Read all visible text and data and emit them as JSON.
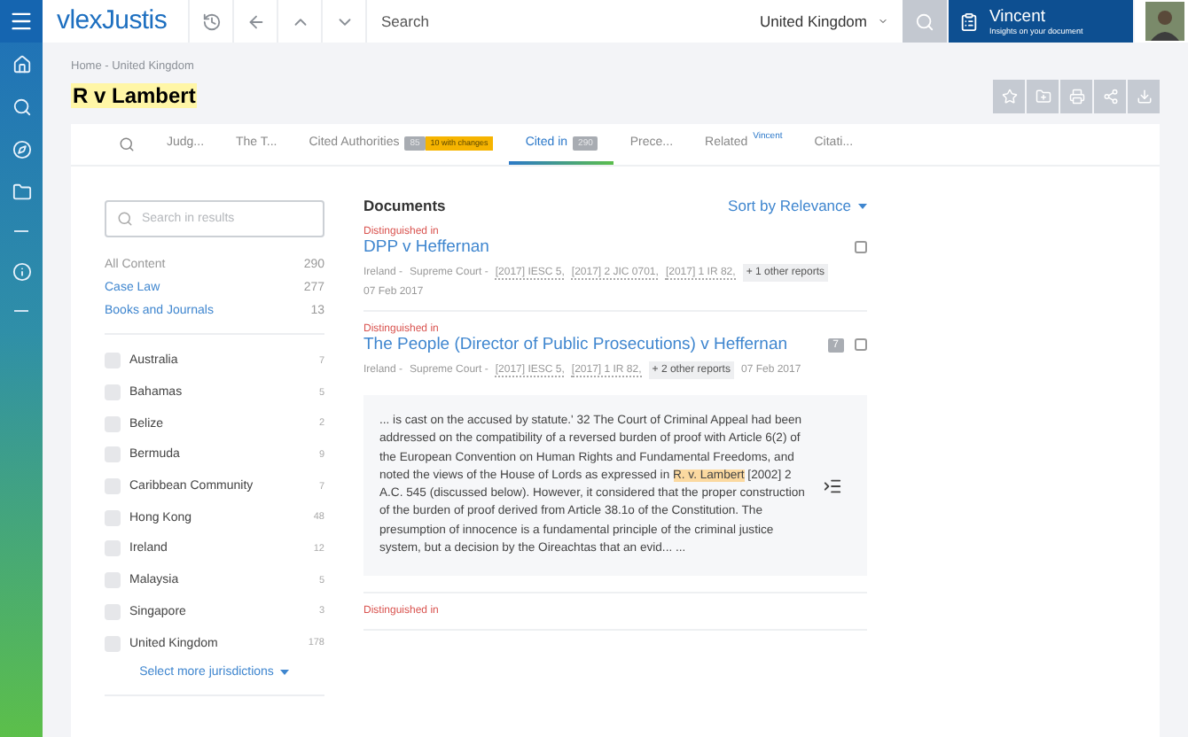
{
  "topbar": {
    "logo": "vlexJustis",
    "search_placeholder": "Search",
    "country": "United Kingdom",
    "assistant": {
      "name": "Vincent",
      "subtitle": "Insights on your document"
    }
  },
  "breadcrumb": [
    "Home",
    "United Kingdom"
  ],
  "breadcrumb_separator": "-",
  "title": "R v Lambert",
  "tabs": [
    {
      "label": "Judg...",
      "selected": false
    },
    {
      "label": "The T...",
      "selected": false
    },
    {
      "label": "Cited Authorities",
      "count": "85",
      "note": "10 with changes",
      "selected": false
    },
    {
      "label": "Cited in",
      "count": "290",
      "selected": true
    },
    {
      "label": "Prece...",
      "selected": false
    },
    {
      "label": "Related",
      "sup": "Vincent",
      "selected": false
    },
    {
      "label": "Citati...",
      "selected": false
    }
  ],
  "results_search": {
    "placeholder": "Search in results"
  },
  "content_filters": [
    {
      "label": "All Content",
      "count": "290",
      "selected": true
    },
    {
      "label": "Case Law",
      "count": "277",
      "selected": false
    },
    {
      "label": "Books and Journals",
      "count": "13",
      "selected": false
    }
  ],
  "jurisdictions": [
    {
      "label": "Australia",
      "count": "7",
      "checked": false
    },
    {
      "label": "Bahamas",
      "count": "5",
      "checked": false
    },
    {
      "label": "Belize",
      "count": "2",
      "checked": false
    },
    {
      "label": "Bermuda",
      "count": "9",
      "checked": false
    },
    {
      "label": "Caribbean Community",
      "count": "7",
      "checked": false
    },
    {
      "label": "Hong Kong",
      "count": "48",
      "checked": false
    },
    {
      "label": "Ireland",
      "count": "12",
      "checked": false
    },
    {
      "label": "Malaysia",
      "count": "5",
      "checked": false
    },
    {
      "label": "Singapore",
      "count": "3",
      "checked": false
    },
    {
      "label": "United Kingdom",
      "count": "178",
      "checked": false
    }
  ],
  "more_jurisdictions": "Select more jurisdictions",
  "documents_heading": "Documents",
  "sort": "Sort by Relevance",
  "documents": [
    {
      "relation": "Distinguished in",
      "title": "DPP v Heffernan",
      "jurisdiction": "Ireland -",
      "court": "Supreme Court -",
      "citations": [
        "[2017] IESC 5,",
        "[2017] 2 JIC 0701,",
        "[2017] 1 IR 82,"
      ],
      "other_reports": "+ 1 other reports",
      "date": "07 Feb 2017",
      "checked": false
    },
    {
      "relation": "Distinguished in",
      "title": "The People (Director of Public Prosecutions) v Heffernan",
      "badge": "7",
      "jurisdiction": "Ireland -",
      "court": "Supreme Court -",
      "citations": [
        "[2017] IESC 5,",
        "[2017] 1 IR 82,"
      ],
      "other_reports": "+ 2 other reports",
      "date": "07 Feb 2017",
      "checked": false,
      "snippet": "... is cast on the accused by statute.' 32 The Court of Criminal Appeal had been addressed on the compatibility of a reversed burden of proof with Article 6(2) of the European Convention on Human Rights and Fundamental Freedoms, and noted the views of the House of Lords as expressed in **R. v. Lambert** [2002] 2 A.C. 545 (discussed below). However, it considered that the proper construction of the burden of proof derived from Article 38.1o of the Constitution. The presumption of innocence is a fundamental principle of the criminal justice system, but a decision by the Oireachtas that an evid... ..."
    },
    {
      "relation": "Distinguished in"
    }
  ]
}
